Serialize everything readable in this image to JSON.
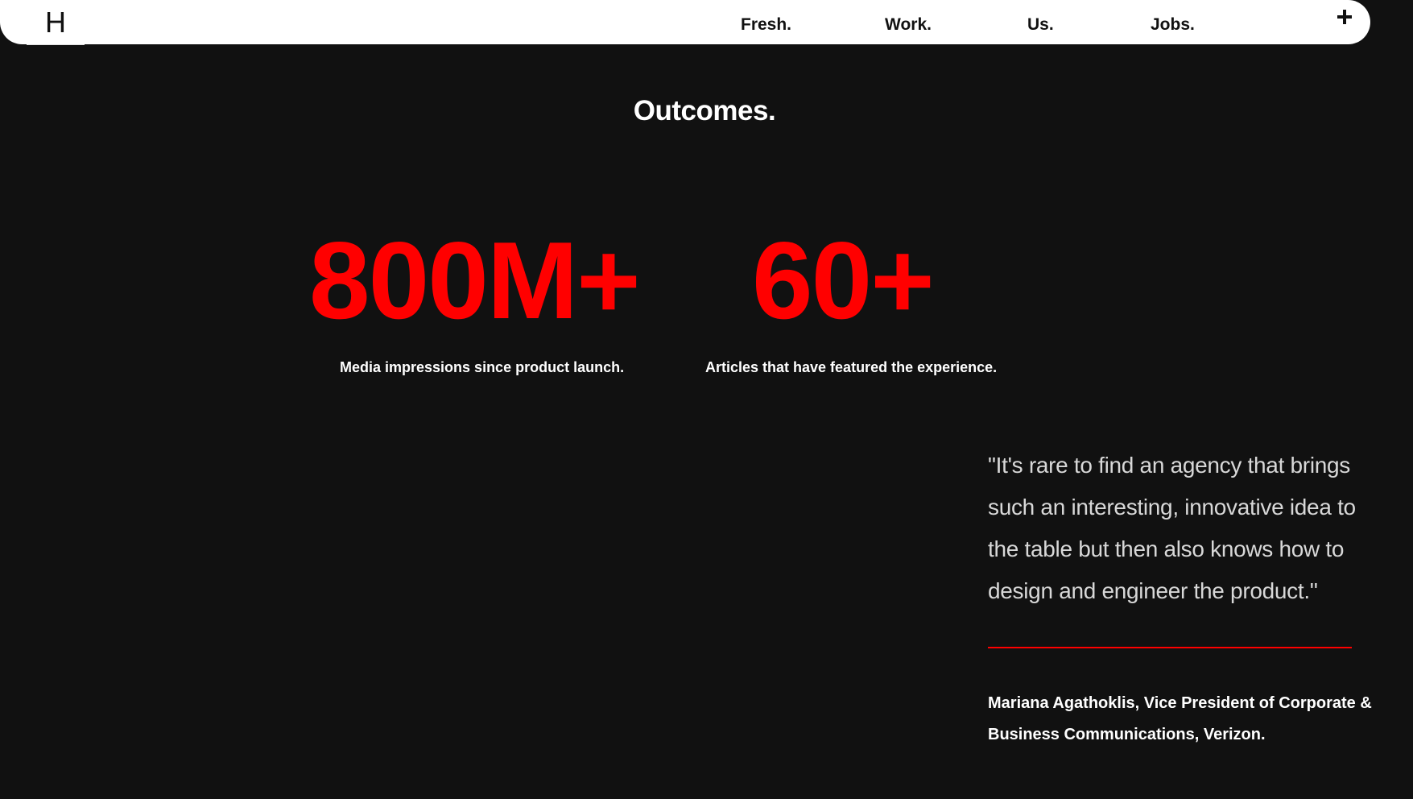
{
  "colors": {
    "background": "#111111",
    "navbar": "#ffffff",
    "accent": "#ff0000",
    "text_primary": "#ffffff",
    "text_quote": "#d8d8d8"
  },
  "header": {
    "logo": "H",
    "nav": [
      {
        "label": "Fresh."
      },
      {
        "label": "Work."
      },
      {
        "label": "Us."
      },
      {
        "label": "Jobs."
      }
    ],
    "menu_icon": "plus-icon"
  },
  "outcomes": {
    "title": "Outcomes.",
    "stats": [
      {
        "value": "800M+",
        "label": "Media impressions since product launch."
      },
      {
        "value": "60+",
        "label": "Articles that have featured the experience."
      }
    ]
  },
  "testimonial": {
    "quote": "\"It's rare to find an agency that brings such an interesting, innovative idea to the table but then also knows how to design and engineer the product.\"",
    "attribution": "Mariana Agathoklis, Vice President of Corporate & Business Communications, Verizon."
  }
}
